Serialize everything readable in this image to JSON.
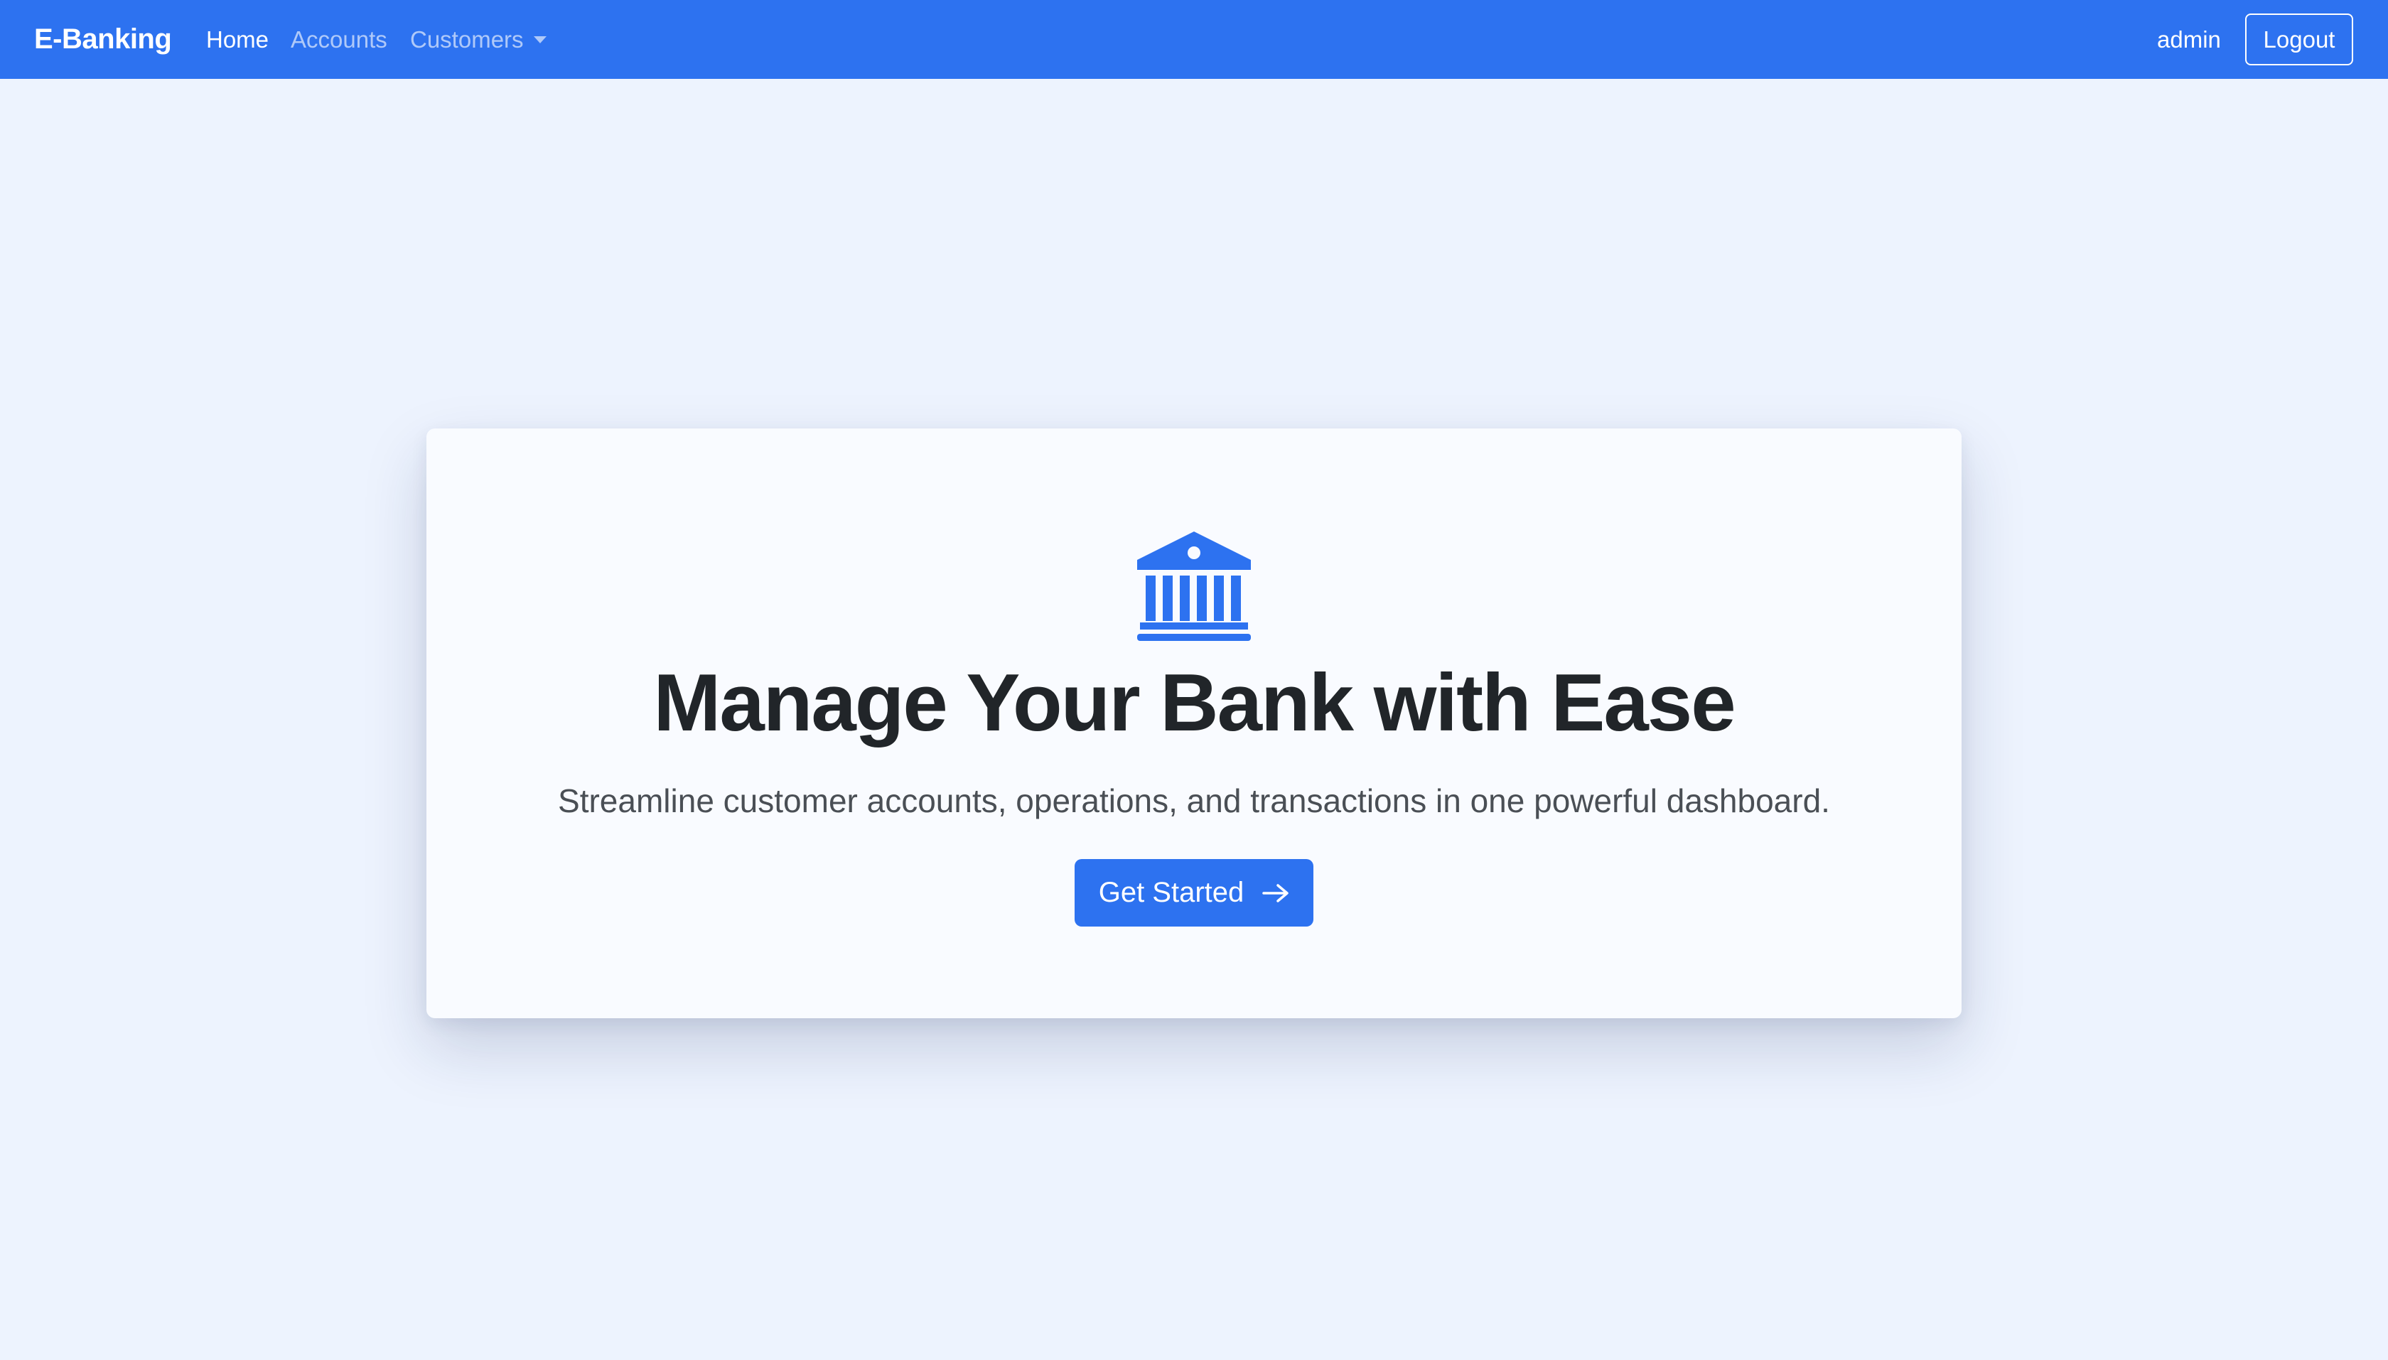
{
  "navbar": {
    "brand": "E-Banking",
    "links": [
      {
        "label": "Home",
        "active": true
      },
      {
        "label": "Accounts",
        "active": false
      },
      {
        "label": "Customers",
        "active": false,
        "dropdown": true
      }
    ],
    "username": "admin",
    "logout_label": "Logout"
  },
  "hero": {
    "icon": "bank-icon",
    "title": "Manage Your Bank with Ease",
    "subtitle": "Streamline customer accounts, operations, and transactions in one powerful dashboard.",
    "cta_label": "Get Started",
    "cta_icon": "arrow-right-icon"
  },
  "colors": {
    "primary": "#2d72f0",
    "background": "#edf3fe",
    "card": "#f9fbff",
    "heading": "#212529",
    "body_text": "#4a4f55"
  }
}
